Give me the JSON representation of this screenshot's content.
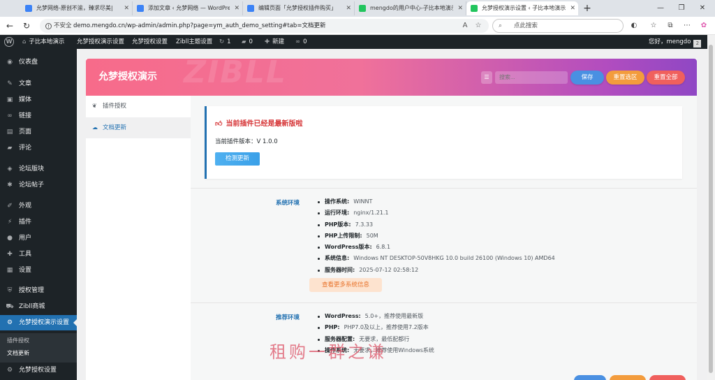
{
  "browser": {
    "tabs": [
      {
        "title": "允梦网络-原创不渝，臻求尽美|",
        "favicon_color": "#3b82f6"
      },
      {
        "title": "添加文章 ‹ 允梦网络 — WordPress",
        "favicon_color": "#3b82f6"
      },
      {
        "title": "编辑页面「允梦授权插件购买」",
        "favicon_color": "#3b82f6"
      },
      {
        "title": "mengdo的用户中心-子比本地演示",
        "favicon_color": "#22c55e"
      },
      {
        "title": "允梦授权演示设置 ‹ 子比本地演示",
        "favicon_color": "#22c55e"
      }
    ],
    "active_tab": 4,
    "new_tab_symbol": "+",
    "window_controls": {
      "minimize": "—",
      "maximize": "❐",
      "close": "✕"
    },
    "address": {
      "security_label": "不安全",
      "url": "demo.mengdo.cn/wp-admin/admin.php?page=ym_auth_demo_setting#tab=文档更新",
      "read_aloud_icon": "A",
      "favorite_icon": "☆"
    },
    "search_placeholder": "点此搜索"
  },
  "admin_bar": {
    "site_name": "子比本地演示",
    "items": [
      "允梦授权演示设置",
      "允梦授权设置",
      "Zibll主题设置"
    ],
    "updates_count": "1",
    "comments_count": "0",
    "new_label": "新建",
    "link_count": "0",
    "greeting": "您好，mengdo"
  },
  "sidebar": {
    "items": [
      {
        "label": "仪表盘",
        "icon": "dashboard-icon",
        "glyph": "◉"
      },
      {
        "label": "文章",
        "icon": "pin-icon",
        "glyph": "✎"
      },
      {
        "label": "媒体",
        "icon": "media-icon",
        "glyph": "▣"
      },
      {
        "label": "链接",
        "icon": "link-icon",
        "glyph": "∞"
      },
      {
        "label": "页面",
        "icon": "page-icon",
        "glyph": "▤"
      },
      {
        "label": "评论",
        "icon": "comment-icon",
        "glyph": "▰"
      },
      {
        "label": "论坛版块",
        "icon": "forum-icon",
        "glyph": "◈"
      },
      {
        "label": "论坛帖子",
        "icon": "posts-icon",
        "glyph": "✱"
      },
      {
        "label": "外观",
        "icon": "appearance-icon",
        "glyph": "✐"
      },
      {
        "label": "插件",
        "icon": "plugin-icon",
        "glyph": "⚡"
      },
      {
        "label": "用户",
        "icon": "user-icon",
        "glyph": "●"
      },
      {
        "label": "工具",
        "icon": "tools-icon",
        "glyph": "✚"
      },
      {
        "label": "设置",
        "icon": "settings-icon",
        "glyph": "▦"
      },
      {
        "label": "授权管理",
        "icon": "shield-icon",
        "glyph": "⛨"
      },
      {
        "label": "Zibll商城",
        "icon": "cart-icon",
        "glyph": "⛟"
      },
      {
        "label": "允梦授权演示设置",
        "icon": "gear-icon",
        "glyph": "⚙"
      },
      {
        "label": "允梦授权设置",
        "icon": "gear-icon",
        "glyph": "⚙"
      }
    ],
    "current_index": 15,
    "submenu": [
      "插件授权",
      "文档更新"
    ],
    "submenu_active": 1
  },
  "panel": {
    "title": "允梦授权演示",
    "watermark": "ZIBLL",
    "search_placeholder": "搜索...",
    "buttons": {
      "save": "保存",
      "reset_section": "重置选区",
      "reset_all": "重置全部"
    },
    "colors": {
      "save": "#4a90e2",
      "reset_section": "#f39c3d",
      "reset_all": "#f0605d"
    },
    "tabs": [
      {
        "label": "插件授权",
        "icon": "leaf-icon",
        "glyph": "❦"
      },
      {
        "label": "文档更新",
        "icon": "cloud-icon",
        "glyph": "☁"
      }
    ],
    "active_tab": 1
  },
  "notice": {
    "title": "当前插件已经是最新版啦",
    "version_label": "当前插件版本：",
    "version": "V 1.0.0",
    "check_button": "检测更新"
  },
  "system_env": {
    "label": "系统环境",
    "rows": [
      {
        "key": "操作系统:",
        "value": "WINNT"
      },
      {
        "key": "运行环境:",
        "value": "nginx/1.21.1"
      },
      {
        "key": "PHP版本:",
        "value": "7.3.33"
      },
      {
        "key": "PHP上传限制:",
        "value": "50M"
      },
      {
        "key": "WordPress版本:",
        "value": "6.8.1"
      },
      {
        "key": "系统信息:",
        "value": "Windows NT DESKTOP-50V8HKG 10.0 build 26100 (Windows 10) AMD64"
      },
      {
        "key": "服务器时间:",
        "value": "2025-07-12 02:58:12"
      }
    ],
    "more_button": "查看更多系统信息"
  },
  "recommend_env": {
    "label": "推荐环境",
    "rows": [
      {
        "key": "WordPress:",
        "value": "5.0+，推荐使用最新版"
      },
      {
        "key": "PHP:",
        "value": "PHP7.0及以上，推荐使用7.2版本"
      },
      {
        "key": "服务器配置:",
        "value": "无要求，最低配都行"
      },
      {
        "key": "操作系统:",
        "value": "无要求，推荐使用Windows系统"
      }
    ]
  },
  "overlay": {
    "text": "租购一群之谦"
  }
}
